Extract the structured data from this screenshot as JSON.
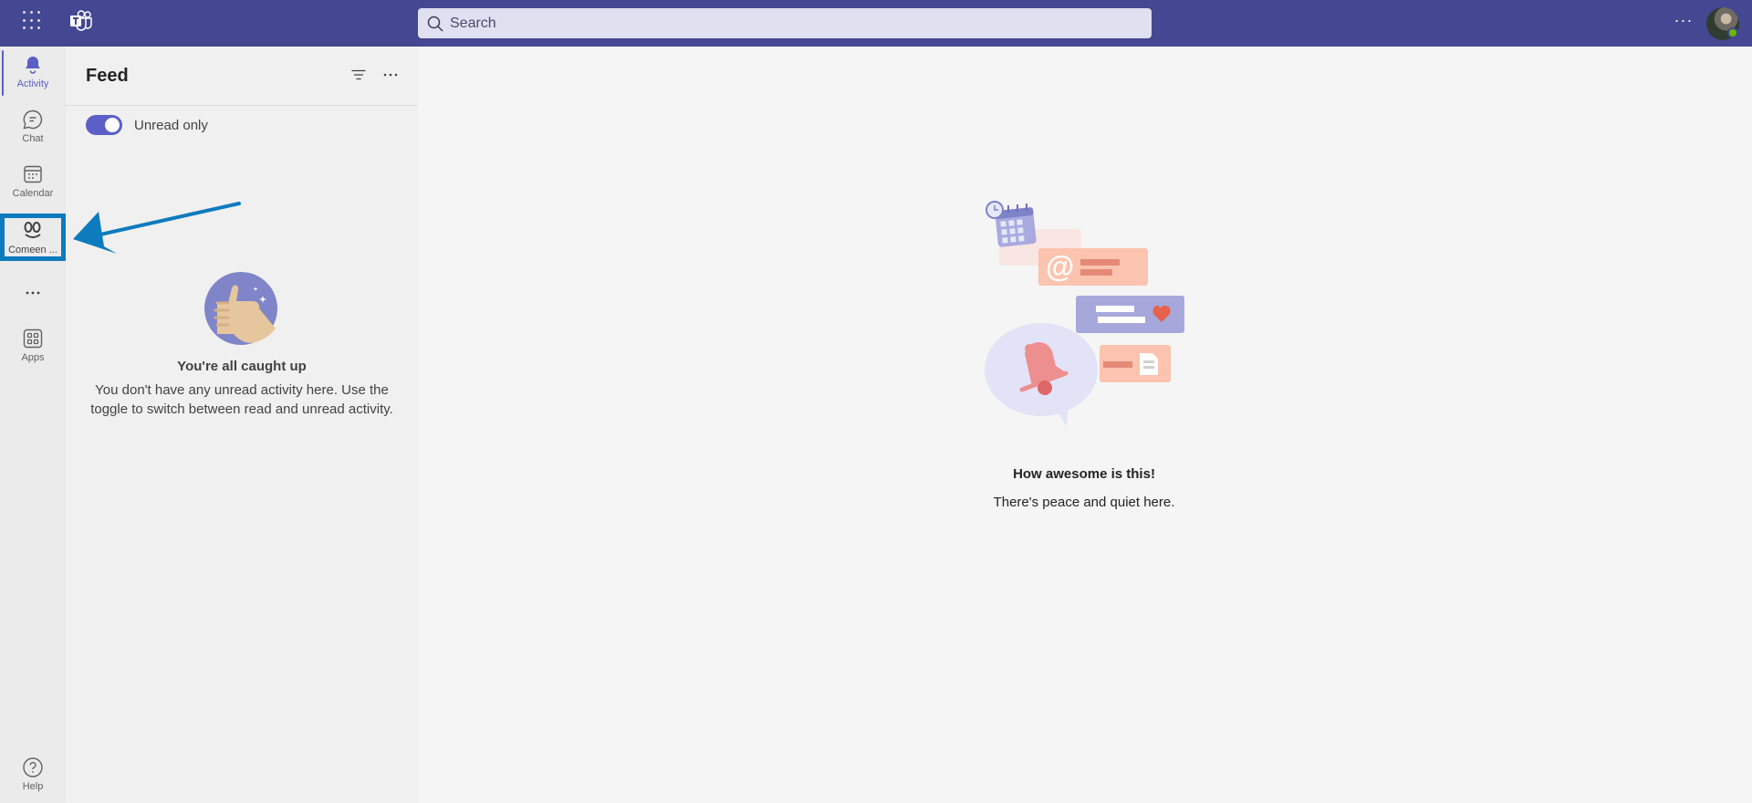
{
  "topbar": {
    "search_placeholder": "Search",
    "more_label": "···"
  },
  "rail": {
    "items": [
      {
        "label": "Activity",
        "icon": "bell-icon",
        "active": true
      },
      {
        "label": "Chat",
        "icon": "chat-icon"
      },
      {
        "label": "Calendar",
        "icon": "calendar-icon"
      },
      {
        "label": "Comeen ...",
        "icon": "comeen-app-icon"
      },
      {
        "label": "",
        "icon": "more-apps-icon"
      },
      {
        "label": "Apps",
        "icon": "apps-icon"
      }
    ],
    "help_label": "Help"
  },
  "feed": {
    "title": "Feed",
    "toggle_label": "Unread only",
    "toggle_on": true,
    "empty_title": "You're all caught up",
    "empty_text": "You don't have any unread activity here. Use the toggle to switch between read and unread activity."
  },
  "main": {
    "title": "How awesome is this!",
    "subtitle": "There's peace and quiet here."
  },
  "colors": {
    "topbar": "#444791",
    "accent": "#5b5fc7",
    "highlight": "#0e7bbe",
    "presence": "#6bb700"
  }
}
